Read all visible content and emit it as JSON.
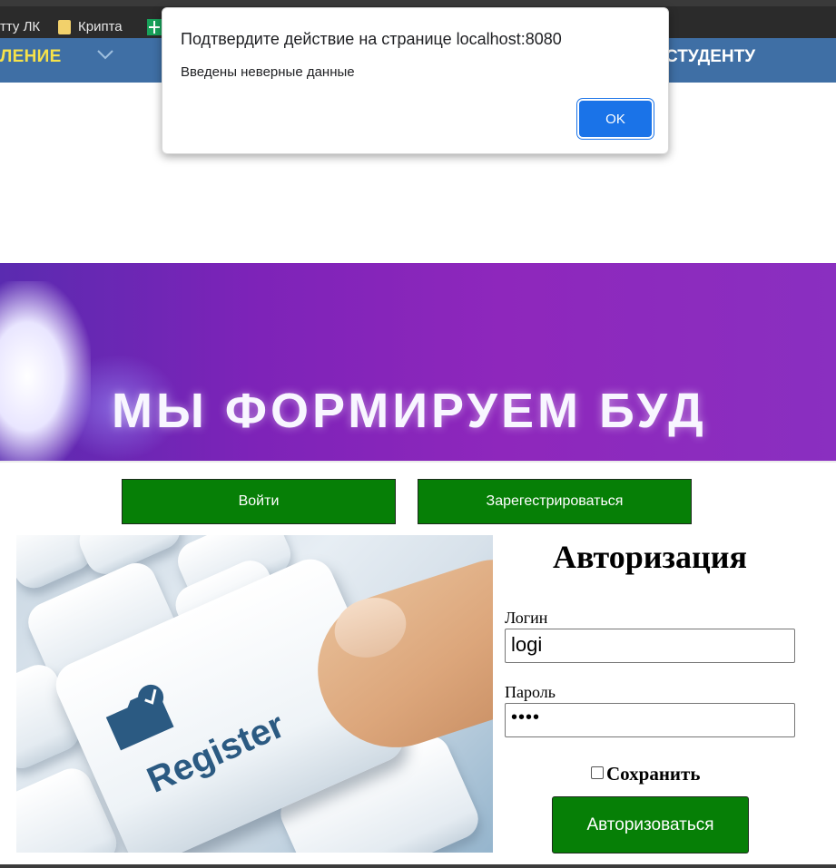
{
  "bookmarks": {
    "items": [
      {
        "label": "тту ЛК",
        "icon": "bookmark-page"
      },
      {
        "label": "Крипта",
        "icon": "folder-icon"
      },
      {
        "label": "",
        "icon": "sheets-icon"
      }
    ]
  },
  "site_nav": {
    "left_label": "ЛЕНИЕ",
    "right_label": "СТУДЕНТУ",
    "accent_color": "#f6e24a",
    "bar_color": "#3f6fa5"
  },
  "banner": {
    "slogan": "МЫ ФОРМИРУЕМ БУД"
  },
  "tabs": {
    "login_label": "Войти",
    "register_label": "Зарегестрироваться",
    "color": "#067f06"
  },
  "illustration": {
    "key_text": "Register"
  },
  "auth": {
    "title": "Авторизация",
    "login_label": "Логин",
    "login_value": "logi",
    "password_label": "Пароль",
    "password_value": "••••",
    "save_label": "Сохранить",
    "save_checked": false,
    "submit_label": "Авторизоваться"
  },
  "dialog": {
    "title": "Подтвердите действие на странице localhost:8080",
    "message": "Введены неверные данные",
    "ok_label": "OK",
    "ok_color": "#1a73e8"
  }
}
